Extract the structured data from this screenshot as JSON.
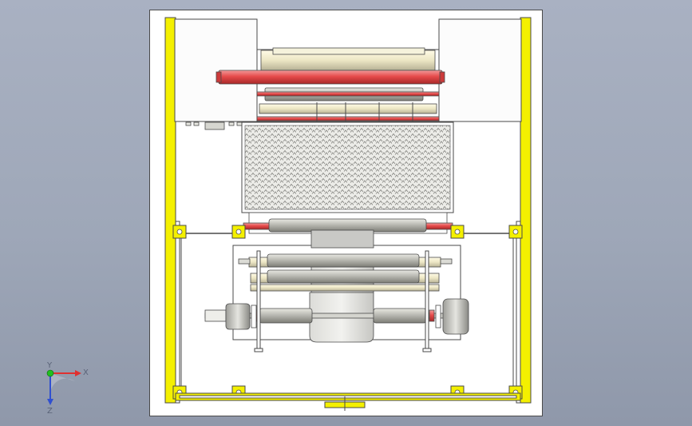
{
  "viewport": {
    "background_top": "#a9b1c2",
    "background_bottom": "#8f98aa",
    "drawing_sheet_color": "#ffffff"
  },
  "colors": {
    "frame_yellow": "#f4f000",
    "roller_red": "#e64b4b",
    "roller_gray": "#b9b9b2",
    "film_gray": "#c9c9c6",
    "mesh_gray": "#b5b5b0",
    "outline": "#4a4a4a",
    "axis_x": "#e03030",
    "axis_y": "#20c020",
    "axis_z": "#3050d0"
  },
  "model": {
    "view": "front",
    "components": [
      "outer-yellow-frame",
      "top-left-cabinet",
      "top-right-cabinet",
      "top-red-roller",
      "upper-roller-assembly",
      "perforated-mesh-panel",
      "middle-red-roller",
      "lower-roller-stack",
      "unwind-shaft",
      "left-motor",
      "right-motor",
      "film-web",
      "base-frame"
    ]
  },
  "triad": {
    "x_label": "X",
    "y_label": "Y",
    "z_label": "Z"
  }
}
